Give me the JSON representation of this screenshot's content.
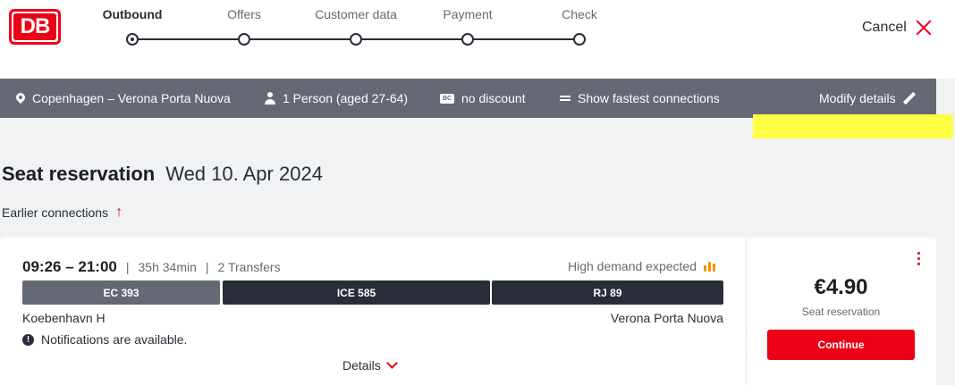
{
  "brand": {
    "logo_text": "DB",
    "accent": "#ec0016"
  },
  "progress": {
    "steps": [
      "Outbound",
      "Offers",
      "Customer data",
      "Payment",
      "Check"
    ],
    "active_index": 0
  },
  "header": {
    "cancel_label": "Cancel",
    "cancel_icon": "close-icon"
  },
  "infobar": {
    "route": "Copenhagen – Verona Porta Nuova",
    "travellers": "1 Person (aged 27-64)",
    "discount_badge": "BC",
    "discount": "no discount",
    "fastest": "Show fastest connections",
    "modify": "Modify details"
  },
  "page": {
    "title": "Seat reservation",
    "date": "Wed 10. Apr 2024",
    "earlier": "Earlier connections"
  },
  "connection": {
    "time_range": "09:26 – 21:00",
    "duration": "35h 34min",
    "transfers": "2 Transfers",
    "demand": "High demand expected",
    "segments": [
      {
        "label": "EC 393",
        "color": "#646973"
      },
      {
        "label": "ICE 585",
        "color": "#282d37"
      },
      {
        "label": "RJ 89",
        "color": "#282d37"
      }
    ],
    "from": "Koebenhavn H",
    "to": "Verona Porta Nuova",
    "notice": "Notifications are available.",
    "details": "Details"
  },
  "offer": {
    "price": "€4.90",
    "label": "Seat reservation",
    "cta": "Continue"
  }
}
